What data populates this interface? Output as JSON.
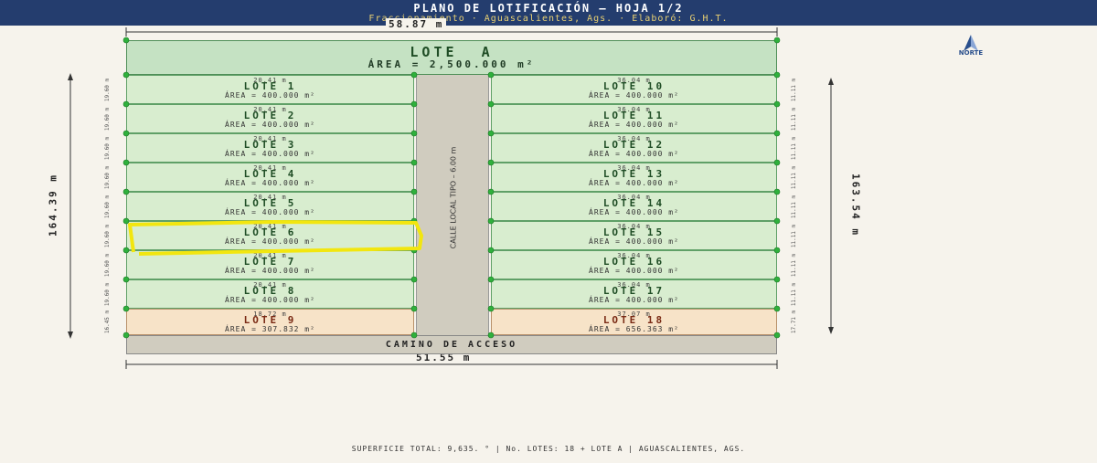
{
  "header": {
    "title": "PLANO DE LOTIFICACIÓN — HOJA 1/2",
    "subtitle": "Fraccionamiento · Aguascalientes, Ags. · Elaboró: G.H.T."
  },
  "dimensions": {
    "top_width": "58.87 m",
    "bottom_width": "51.55 m",
    "left_height": "164.39 m",
    "right_height": "163.54 m"
  },
  "north_label": "NORTE",
  "lote_a": {
    "name": "LOTE  A",
    "area": "ÁREA = 2,500.000 m²"
  },
  "street_label": "CALLE LOCAL TIPO – 6.00 m",
  "access_road": "CAMINO DE ACCESO",
  "left_lots": [
    {
      "name": "LOTE 1",
      "width": "20.41 m",
      "area": "ÁREA = 400.000 m²",
      "side": "19.60 m"
    },
    {
      "name": "LOTE 2",
      "width": "20.41 m",
      "area": "ÁREA = 400.000 m²",
      "side": "19.60 m"
    },
    {
      "name": "LOTE 3",
      "width": "20.41 m",
      "area": "ÁREA = 400.000 m²",
      "side": "19.60 m"
    },
    {
      "name": "LOTE 4",
      "width": "20.41 m",
      "area": "ÁREA = 400.000 m²",
      "side": "19.60 m"
    },
    {
      "name": "LOTE 5",
      "width": "20.41 m",
      "area": "ÁREA = 400.000 m²",
      "side": "19.60 m"
    },
    {
      "name": "LOTE 6",
      "width": "20.41 m",
      "area": "ÁREA = 400.000 m²",
      "side": "19.60 m"
    },
    {
      "name": "LOTE 7",
      "width": "20.41 m",
      "area": "ÁREA = 400.000 m²",
      "side": "19.60 m"
    },
    {
      "name": "LOTE 8",
      "width": "20.41 m",
      "area": "ÁREA = 400.000 m²",
      "side": "19.60 m"
    },
    {
      "name": "LOTE 9",
      "width": "18.72 m",
      "area": "ÁREA = 307.832 m²",
      "side": "16.45 m"
    }
  ],
  "right_lots": [
    {
      "name": "LOTE 10",
      "width": "36.04 m",
      "area": "ÁREA = 400.000 m²",
      "side": "11.11 m"
    },
    {
      "name": "LOTE 11",
      "width": "36.04 m",
      "area": "ÁREA = 400.000 m²",
      "side": "11.11 m"
    },
    {
      "name": "LOTE 12",
      "width": "36.04 m",
      "area": "ÁREA = 400.000 m²",
      "side": "11.11 m"
    },
    {
      "name": "LOTE 13",
      "width": "36.04 m",
      "area": "ÁREA = 400.000 m²",
      "side": "11.11 m"
    },
    {
      "name": "LOTE 14",
      "width": "36.04 m",
      "area": "ÁREA = 400.000 m²",
      "side": "11.11 m"
    },
    {
      "name": "LOTE 15",
      "width": "36.04 m",
      "area": "ÁREA = 400.000 m²",
      "side": "11.11 m"
    },
    {
      "name": "LOTE 16",
      "width": "36.04 m",
      "area": "ÁREA = 400.000 m²",
      "side": "11.11 m"
    },
    {
      "name": "LOTE 17",
      "width": "36.04 m",
      "area": "ÁREA = 400.000 m²",
      "side": "11.11 m"
    },
    {
      "name": "LOTE 18",
      "width": "37.07 m",
      "area": "ÁREA = 656.363 m²",
      "side": "17.71 m"
    }
  ],
  "highlighted_lot": "LOTE 6",
  "footer": "SUPERFICIE TOTAL: 9,635.    °   |   No. LOTES: 18 + LOTE A   |   AGUASCALIENTES, AGS.",
  "colors": {
    "header_bg": "#243d6e",
    "lot_fill": "#d8edcf",
    "corner_lot_fill": "#f7e3c8",
    "road_fill": "#d0ccbf",
    "highlight": "#f2e60f",
    "vertex_dot": "#2fb03c"
  }
}
